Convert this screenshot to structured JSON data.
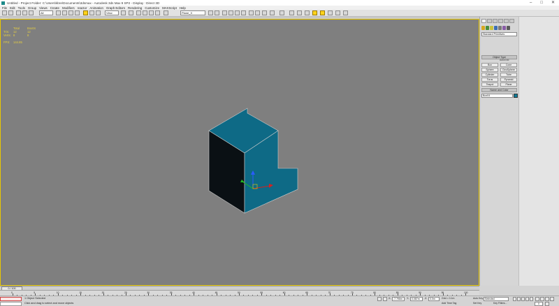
{
  "window": {
    "title": "Untitled    -  Project Folder: C:\\Users\\kbre\\Documents\\3dsmax      -  Autodesk 3ds Max 9 SP2      -  Display : Direct 3D",
    "controls": [
      "–",
      "□",
      "✕"
    ]
  },
  "menu": [
    "File",
    "Edit",
    "Tools",
    "Group",
    "Views",
    "Create",
    "Modifiers",
    "reactor",
    "Animation",
    "Graph Editors",
    "Rendering",
    "Customize",
    "MAXScript",
    "Help"
  ],
  "toolbar": {
    "selection_filter": "All",
    "reference_coord": "View",
    "named_selection": "Plane_X"
  },
  "viewport": {
    "label": "Persp",
    "stats": {
      "header": [
        "",
        "Total",
        "Box04"
      ],
      "rows": [
        [
          "Tris:",
          "12",
          "12"
        ],
        [
          "Verts:",
          "8",
          "8"
        ]
      ],
      "fps_label": "FPS:",
      "fps_value": "144.85"
    }
  },
  "command_panel": {
    "category": "Standard Primitives",
    "rollout_object_type": "Object Type",
    "autogrid": "AutoGrid",
    "object_buttons": [
      "Box",
      "Cone",
      "Sphere",
      "GeoSphere",
      "Cylinder",
      "Tube",
      "Torus",
      "Pyramid",
      "Teapot",
      "Plane"
    ],
    "rollout_name_color": "Name and Color",
    "object_name": "Box04",
    "object_color": "#0f7a96"
  },
  "timeline": {
    "slider_label": "0 / 100",
    "ticks": [
      "0",
      "5",
      "10",
      "15",
      "20",
      "25",
      "30",
      "35",
      "40",
      "45",
      "50",
      "55",
      "60",
      "65",
      "70",
      "75",
      "80",
      "85",
      "90",
      "95",
      "100"
    ],
    "current_frame_fraction": 0
  },
  "status": {
    "selection": "1 Object Selected",
    "prompt": "Click and drag to select and move objects",
    "x_label": "X:",
    "x_value": "-7.796m",
    "y_label": "Y:",
    "y_value": "0.087m",
    "z_label": "Z:",
    "z_value": "0.0m",
    "grid": "Grid = 0.1m",
    "add_time_tag": "Add Time Tag",
    "auto_key": "Auto Key",
    "set_key": "Set Key",
    "selected": "Selected",
    "key_filters": "Key Filters...",
    "frame": "0"
  }
}
